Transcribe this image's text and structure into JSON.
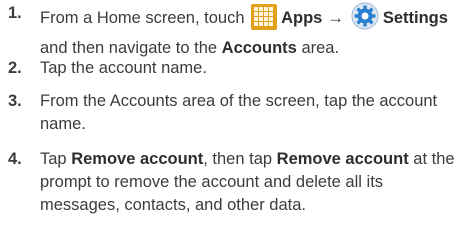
{
  "steps": [
    {
      "number": "1.",
      "parts": {
        "t1": "From a Home screen, touch",
        "apps_label": "Apps",
        "arrow": "→",
        "settings_label": "Settings",
        "t2": "and then navigate to the",
        "accounts_label": "Accounts",
        "t3": "area."
      },
      "icons": [
        "apps-grid-icon",
        "settings-gear-icon"
      ]
    },
    {
      "number": "2.",
      "text": "Tap the account name."
    },
    {
      "number": "3.",
      "line1": "From the Accounts area of the screen, tap the account",
      "line2": "name."
    },
    {
      "number": "4.",
      "parts": {
        "t1": "Tap",
        "remove1": "Remove account",
        "t2": ", then tap",
        "remove2": "Remove account",
        "t3": "at the",
        "line2": "prompt to remove the account and delete all its",
        "line3": "messages, contacts, and other data."
      }
    }
  ],
  "colors": {
    "text": "#3c3c3c",
    "apps_icon": "#e2a11b",
    "settings_icon": "#2c7fd0"
  }
}
